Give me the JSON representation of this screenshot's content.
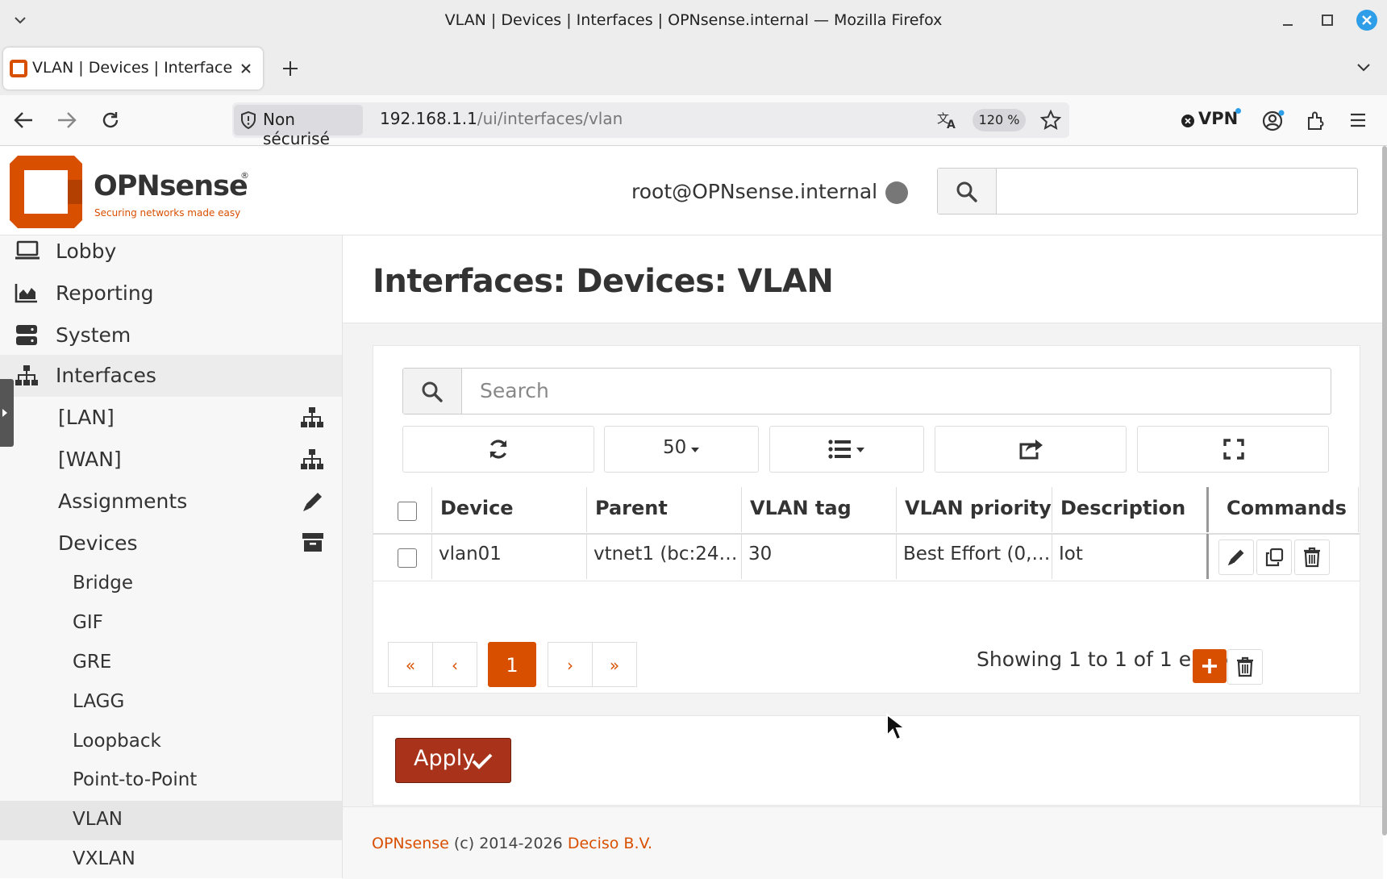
{
  "window": {
    "title": "VLAN | Devices | Interfaces | OPNsense.internal — Mozilla Firefox"
  },
  "browser": {
    "tab_title": "VLAN | Devices | Interfaces | OPNsense.internal",
    "security_label": "Non sécurisé",
    "url_host": "192.168.1.1",
    "url_path": "/ui/interfaces/vlan",
    "zoom": "120 %",
    "vpn_label": "VPN"
  },
  "header": {
    "logo_name": "OPNsense",
    "logo_tagline": "Securing networks made easy",
    "user": "root@OPNsense.internal"
  },
  "sidebar": {
    "items": [
      {
        "label": "Lobby",
        "icon": "laptop-icon"
      },
      {
        "label": "Reporting",
        "icon": "area-chart-icon"
      },
      {
        "label": "System",
        "icon": "server-icon"
      },
      {
        "label": "Interfaces",
        "icon": "sitemap-icon"
      }
    ],
    "interfaces_sub": [
      {
        "label": "[LAN]",
        "icon": "sitemap-icon"
      },
      {
        "label": "[WAN]",
        "icon": "sitemap-icon"
      },
      {
        "label": "Assignments",
        "icon": "pencil-icon"
      },
      {
        "label": "Devices",
        "icon": "archive-icon"
      }
    ],
    "devices_sub": [
      "Bridge",
      "GIF",
      "GRE",
      "LAGG",
      "Loopback",
      "Point-to-Point",
      "VLAN",
      "VXLAN"
    ],
    "active": "VLAN"
  },
  "main": {
    "title": "Interfaces: Devices: VLAN",
    "search_placeholder": "Search",
    "page_size": "50",
    "columns": [
      "Device",
      "Parent",
      "VLAN tag",
      "VLAN priority",
      "Description",
      "Commands"
    ],
    "rows": [
      {
        "device": "vlan01",
        "parent": "vtnet1 (bc:24…",
        "tag": "30",
        "priority": "Best Effort (0,…",
        "description": "Iot"
      }
    ],
    "pager": {
      "first": "«",
      "prev": "‹",
      "current": "1",
      "next": "›",
      "last": "»"
    },
    "entries_text": "Showing 1 to 1 of 1 entries",
    "apply_label": "Apply"
  },
  "footer": {
    "brand": "OPNsense",
    "copyright": " (c) 2014-2026 ",
    "company": "Deciso B.V."
  },
  "colors": {
    "accent": "#d94f00",
    "apply": "#a8321a",
    "vpn_dot": "#2f9ee8"
  }
}
